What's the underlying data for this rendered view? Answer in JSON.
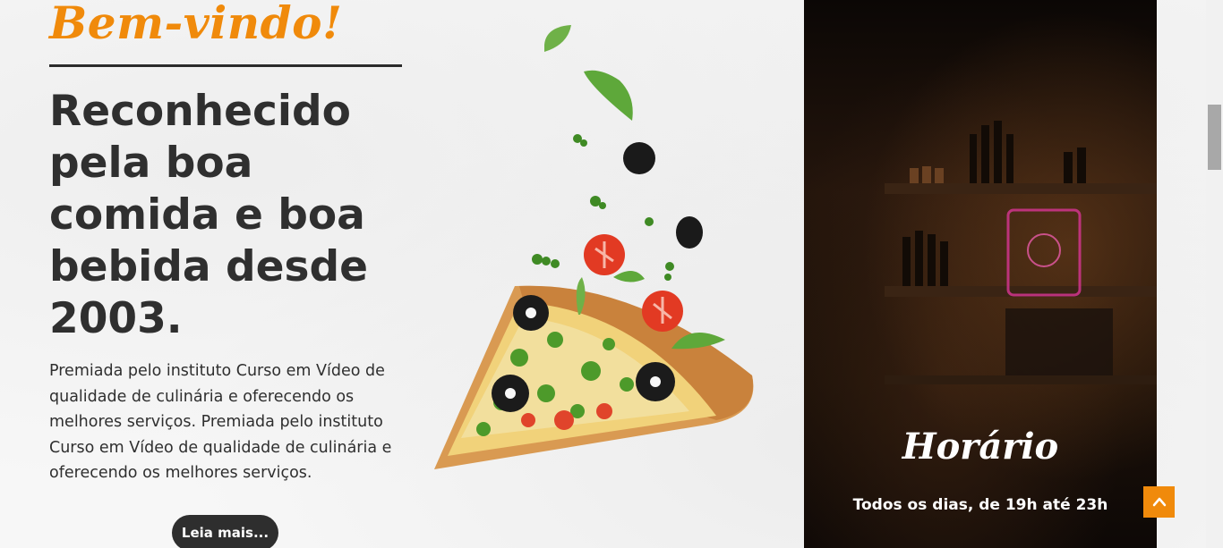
{
  "intro": {
    "welcome": "Bem-vindo!",
    "headline": "Reconhecido pela boa comida e boa bebida desde 2003.",
    "description": "Premiada pelo instituto Curso em Vídeo de qualidade de culinária e oferecendo os melhores serviços. Premiada pelo instituto Curso em Vídeo de qualidade de culinária e oferecendo os melhores serviços.",
    "read_more": "Leia mais..."
  },
  "hours": {
    "title": "Horário",
    "text": "Todos os dias, de 19h até 23h"
  },
  "colors": {
    "accent": "#f08a0b",
    "text_dark": "#2f2f2f",
    "button_dark": "#2e2e2e"
  },
  "icons": {
    "back_to_top": "chevron-up-icon"
  }
}
